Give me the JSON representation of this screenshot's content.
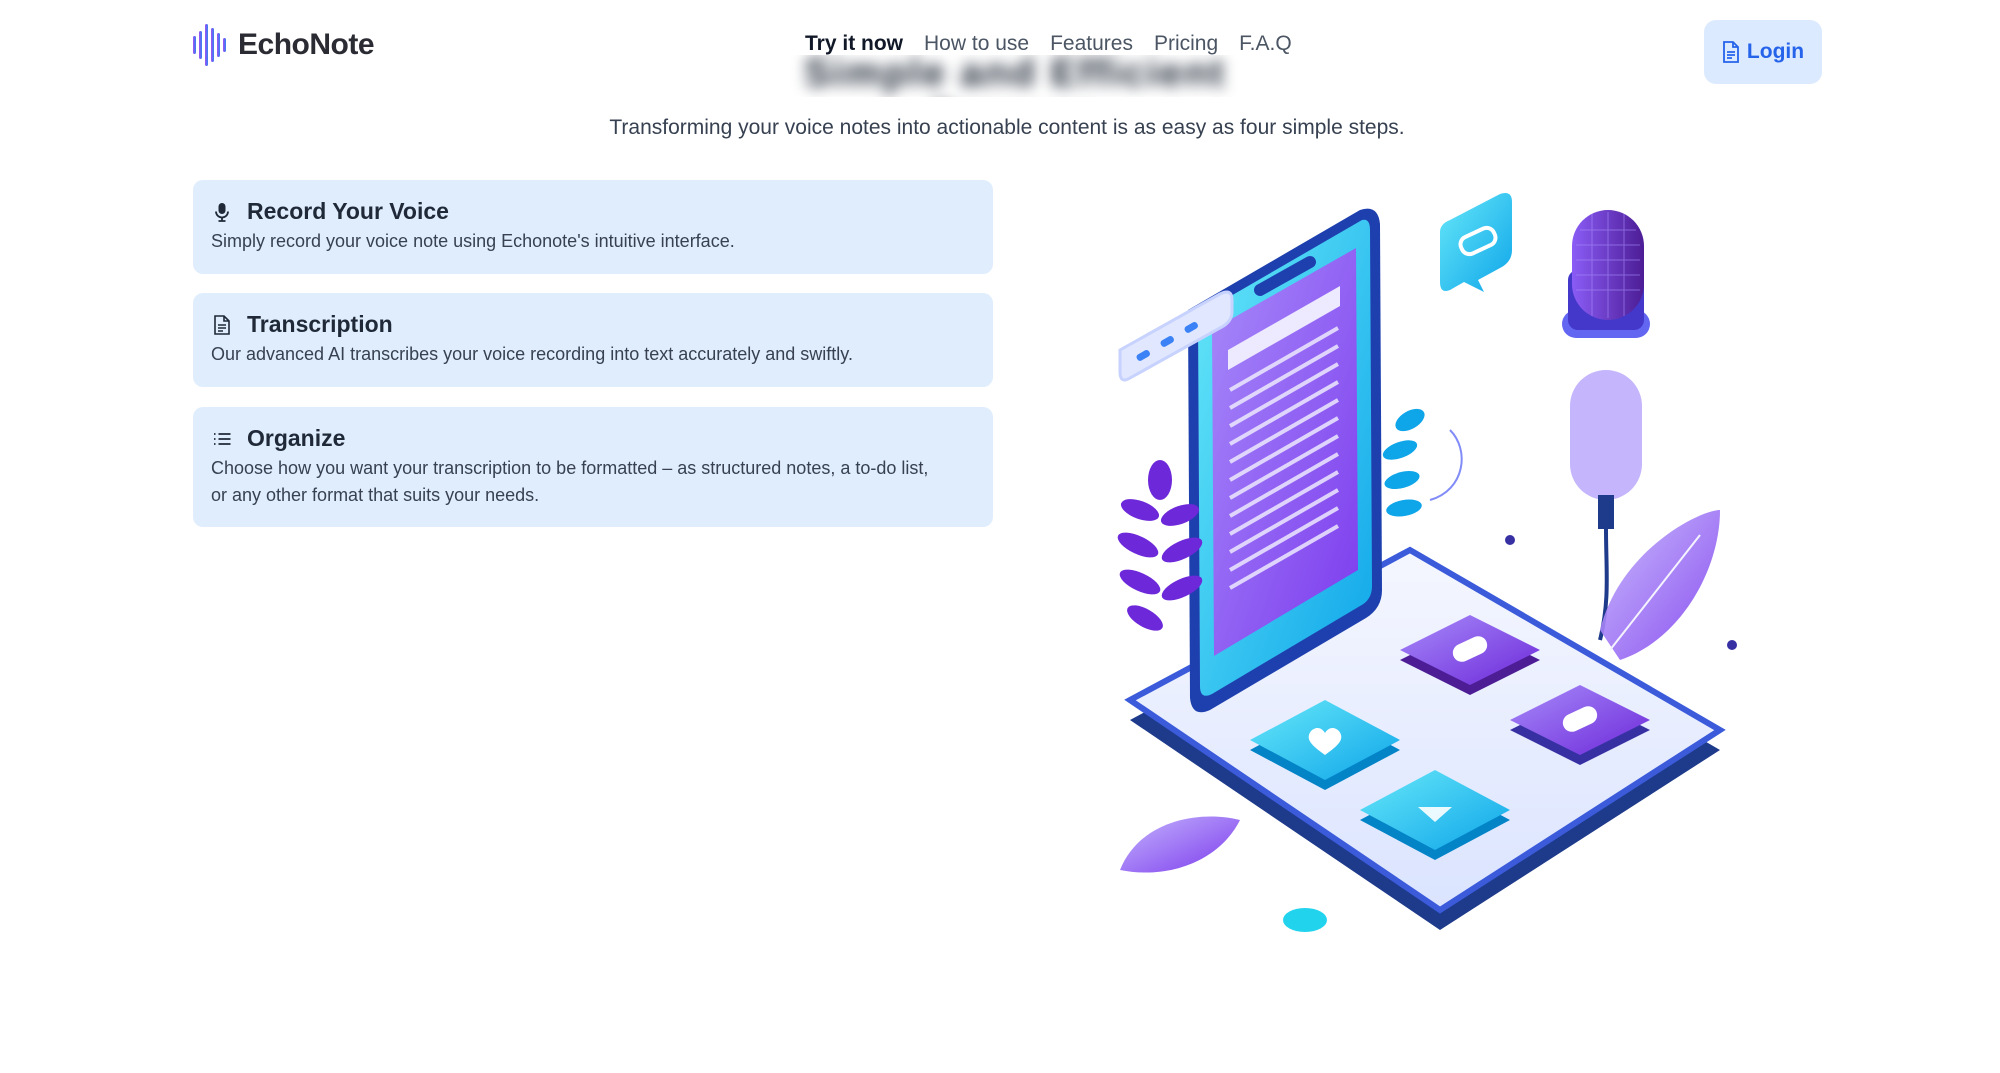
{
  "brand": {
    "name": "EchoNote"
  },
  "nav": [
    {
      "label": "Try it now",
      "active": true
    },
    {
      "label": "How to use",
      "active": false
    },
    {
      "label": "Features",
      "active": false
    },
    {
      "label": "Pricing",
      "active": false
    },
    {
      "label": "F.A.Q",
      "active": false
    }
  ],
  "login": {
    "label": "Login",
    "icon": "document-icon"
  },
  "section": {
    "subtitle": "Transforming your voice notes into actionable content is as easy as four simple steps."
  },
  "steps": [
    {
      "icon": "microphone-icon",
      "title": "Record Your Voice",
      "description": "Simply record your voice note using Echonote's intuitive interface."
    },
    {
      "icon": "document-icon",
      "title": "Transcription",
      "description": "Our advanced AI transcribes your voice recording into text accurately and swiftly."
    },
    {
      "icon": "list-icon",
      "title": "Organize",
      "description": "Choose how you want your transcription to be formatted – as structured notes, a to-do list, or any other format that suits your needs."
    }
  ],
  "colors": {
    "accent": "#2563eb",
    "card_bg": "#e0edfd",
    "login_bg": "#dbeafe",
    "brand_purple": "#7c3aed"
  }
}
